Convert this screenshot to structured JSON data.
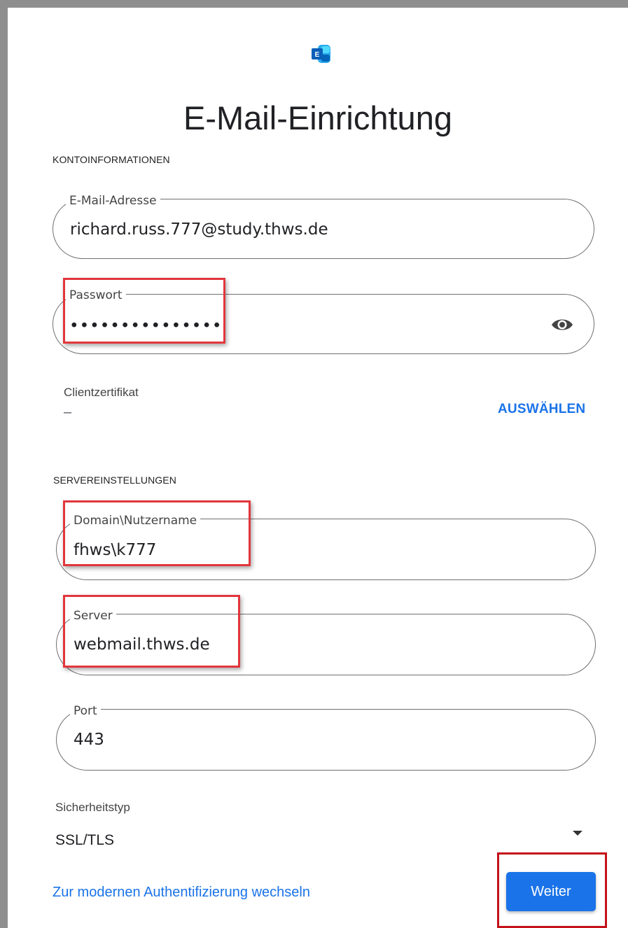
{
  "header": {
    "logo_icon": "exchange-icon",
    "title": "E-Mail-Einrichtung"
  },
  "account": {
    "section_title": "KONTOINFORMATIONEN",
    "email_label": "E-Mail-Adresse",
    "email_value": "richard.russ.777@study.thws.de",
    "password_label": "Passwort",
    "password_value": "•••••••••••••••",
    "password_toggle_icon": "eye-icon",
    "cert_label": "Clientzertifikat",
    "cert_value": "–",
    "cert_select": "AUSWÄHLEN"
  },
  "server": {
    "section_title": "SERVEREINSTELLUNGEN",
    "domain_label": "Domain\\Nutzername",
    "domain_value": "fhws\\k777",
    "server_label": "Server",
    "server_value": "webmail.thws.de",
    "port_label": "Port",
    "port_value": "443",
    "security_label": "Sicherheitstyp",
    "security_value": "SSL/TLS",
    "dropdown_icon": "dropdown-arrow-icon"
  },
  "footer": {
    "modern_auth_link": "Zur modernen Authentifizierung wechseln",
    "next_button": "Weiter"
  },
  "colors": {
    "accent": "#1a73e8",
    "highlight": "#e2363c"
  }
}
